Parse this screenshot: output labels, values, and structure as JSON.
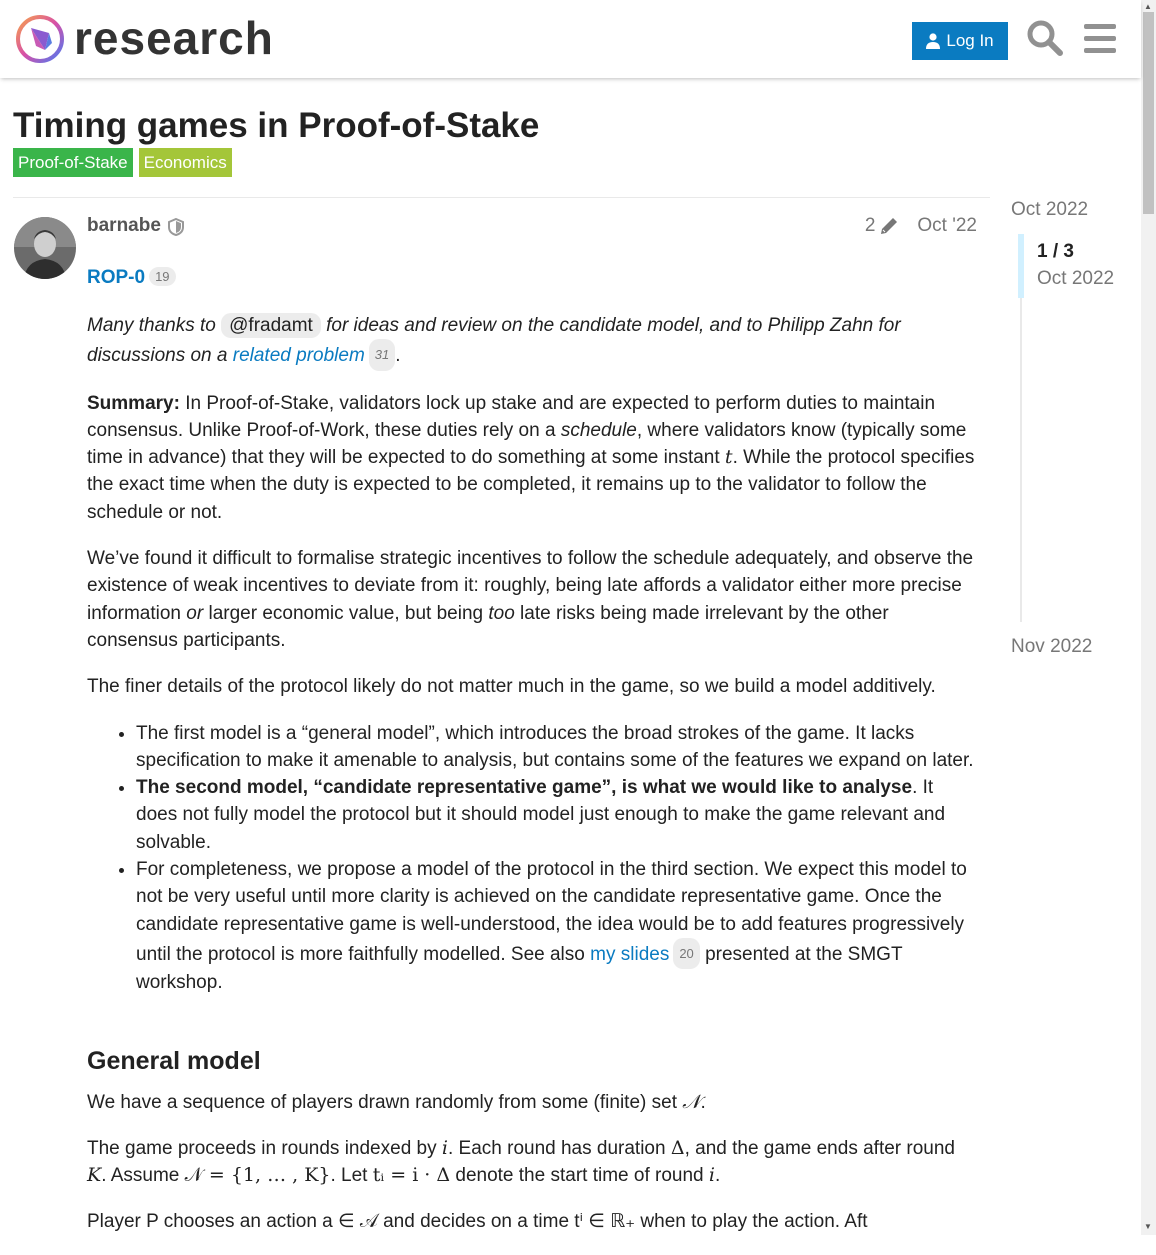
{
  "header": {
    "brand": "research",
    "login_label": "Log In"
  },
  "topic": {
    "title": "Timing games in Proof-of-Stake",
    "tags": [
      {
        "label": "Proof-of-Stake",
        "color": "#3ab54a"
      },
      {
        "label": "Economics",
        "color": "#a4c639"
      }
    ]
  },
  "post": {
    "username": "barnabe",
    "edits": "2",
    "date": "Oct '22",
    "ref_link": "ROP-0",
    "ref_clicks": "19",
    "thanks": {
      "pre": "Many thanks to ",
      "mention": "@fradamt",
      "mid": " for ideas and review on the candidate model, and to Philipp Zahn for discussions on a ",
      "link": "related problem",
      "link_clicks": "31",
      "post": "."
    },
    "summary": {
      "label": "Summary:",
      "t1": " In Proof-of-Stake, validators lock up stake and are expected to perform duties to maintain consensus. Unlike Proof-of-Work, these duties rely on a ",
      "em": "schedule",
      "t2": ", where validators know (typically some time in advance) that they will be expected to do something at some instant ",
      "var": "t",
      "t3": ". While the protocol specifies the exact time when the duty is expected to be completed, it remains up to the validator to follow the schedule or not."
    },
    "p2": {
      "t1": "We’ve found it difficult to formalise strategic incentives to follow the schedule adequately, and observe the existence of weak incentives to deviate from it: roughly, being late affords a validator either more precise information ",
      "em1": "or",
      "t2": " larger economic value, but being ",
      "em2": "too",
      "t3": " late risks being made irrelevant by the other consensus participants."
    },
    "p3": "The finer details of the protocol likely do not matter much in the game, so we build a model additively.",
    "list": {
      "item1": "The first model is a “general model”, which introduces the broad strokes of the game. It lacks specification to make it amenable to analysis, but contains some of the features we expand on later.",
      "item2_bold": "The second model, “candidate representative game”, is what we would like to analyse",
      "item2_rest": ". It does not fully model the protocol but it should model just enough to make the game relevant and solvable.",
      "item3_pre": "For completeness, we propose a model of the protocol in the third section. We expect this model to not be very useful until more clarity is achieved on the candidate representative game. Once the candidate representative game is well-understood, the idea would be to add features progressively until the protocol is more faithfully modelled. See also ",
      "item3_link": "my slides",
      "item3_clicks": "20",
      "item3_post": " presented at the SMGT workshop."
    },
    "general_model": {
      "heading": "General model",
      "p1_pre": "We have a sequence of players drawn randomly from some (finite) set ",
      "p1_math": "𝒩",
      "p1_post": ".",
      "p2_a": "The game proceeds in rounds indexed by ",
      "p2_i": "i",
      "p2_b": ". Each round has duration ",
      "p2_delta": "Δ",
      "p2_c": ", and the game ends after round ",
      "p2_K": "K",
      "p2_d": ". Assume ",
      "p2_set": "𝒩 = {1, … , K}",
      "p2_e": ". Let ",
      "p2_ti": "tᵢ = i · Δ",
      "p2_f": " denote the start time of round ",
      "p2_i2": "i",
      "p2_g": ".",
      "p3_cut": "Player P chooses an action a ∈ 𝒜 and decides on a time tⁱ ∈ ℝ₊ when to play the action. Aft"
    }
  },
  "timeline": {
    "top": "Oct 2022",
    "position": "1 / 3",
    "current_date": "Oct 2022",
    "bottom": "Nov 2022"
  }
}
